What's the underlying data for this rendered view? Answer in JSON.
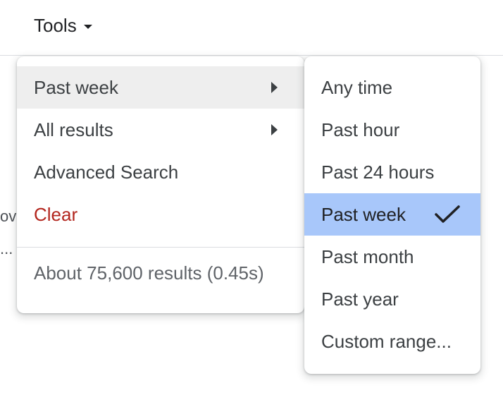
{
  "header": {
    "tools_label": "Tools",
    "tools_caret_icon": "caret-down-icon"
  },
  "background": {
    "fragment_1": "ov",
    "fragment_2": "..."
  },
  "main_menu": {
    "items": [
      {
        "label": "Past week",
        "has_submenu": true,
        "highlighted": true,
        "icon": "chevron-right-icon"
      },
      {
        "label": "All results",
        "has_submenu": true,
        "highlighted": false,
        "icon": "chevron-right-icon"
      },
      {
        "label": "Advanced Search",
        "has_submenu": false
      },
      {
        "label": "Clear",
        "has_submenu": false,
        "color": "#b3261e"
      }
    ],
    "results_stats": "About 75,600 results (0.45s)"
  },
  "time_submenu": {
    "items": [
      {
        "label": "Any time"
      },
      {
        "label": "Past hour"
      },
      {
        "label": "Past 24 hours"
      },
      {
        "label": "Past week",
        "selected": true,
        "icon": "checkmark-icon"
      },
      {
        "label": "Past month"
      },
      {
        "label": "Past year"
      },
      {
        "label": "Custom range..."
      }
    ],
    "selected_color": "#a8c7fa"
  }
}
